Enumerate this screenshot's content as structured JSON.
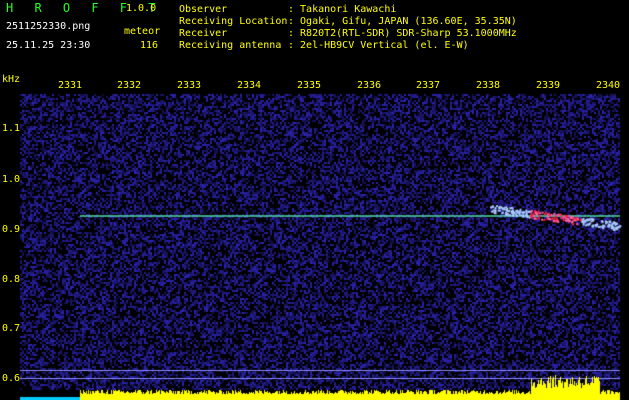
{
  "header": {
    "app_name": "H R O F F T",
    "version": "1.0.0",
    "filename": "2511252330.png",
    "category_label": "meteor",
    "datetime": "25.11.25 23:30",
    "count": "116",
    "info_labels": [
      "Observer",
      "Receiving Location",
      "Receiver",
      "Receiving antenna"
    ],
    "info_values": [
      ": Takanori Kawachi",
      ": Ogaki, Gifu, JAPAN (136.60E, 35.35N)",
      ": R820T2(RTL-SDR) SDR-Sharp 53.1000MHz",
      ": 2el-HB9CV Vertical (el. E-W)"
    ]
  },
  "axes": {
    "y_unit": "kHz",
    "y_ticks": [
      "1.1",
      "1.0",
      "0.9",
      "0.8",
      "0.7",
      "0.6"
    ],
    "x_ticks": [
      "2331",
      "2332",
      "2333",
      "2334",
      "2335",
      "2336",
      "2337",
      "2338",
      "2339",
      "2340"
    ]
  },
  "colors": {
    "background": "#000000",
    "text": "#ffff00",
    "brand": "#22ff22",
    "noise": "#1a1a9a",
    "carrier": "#55ddaa",
    "echo_hot": "#ff2244",
    "level_bars": "#ffff00",
    "level_base": "#00ccff"
  }
}
